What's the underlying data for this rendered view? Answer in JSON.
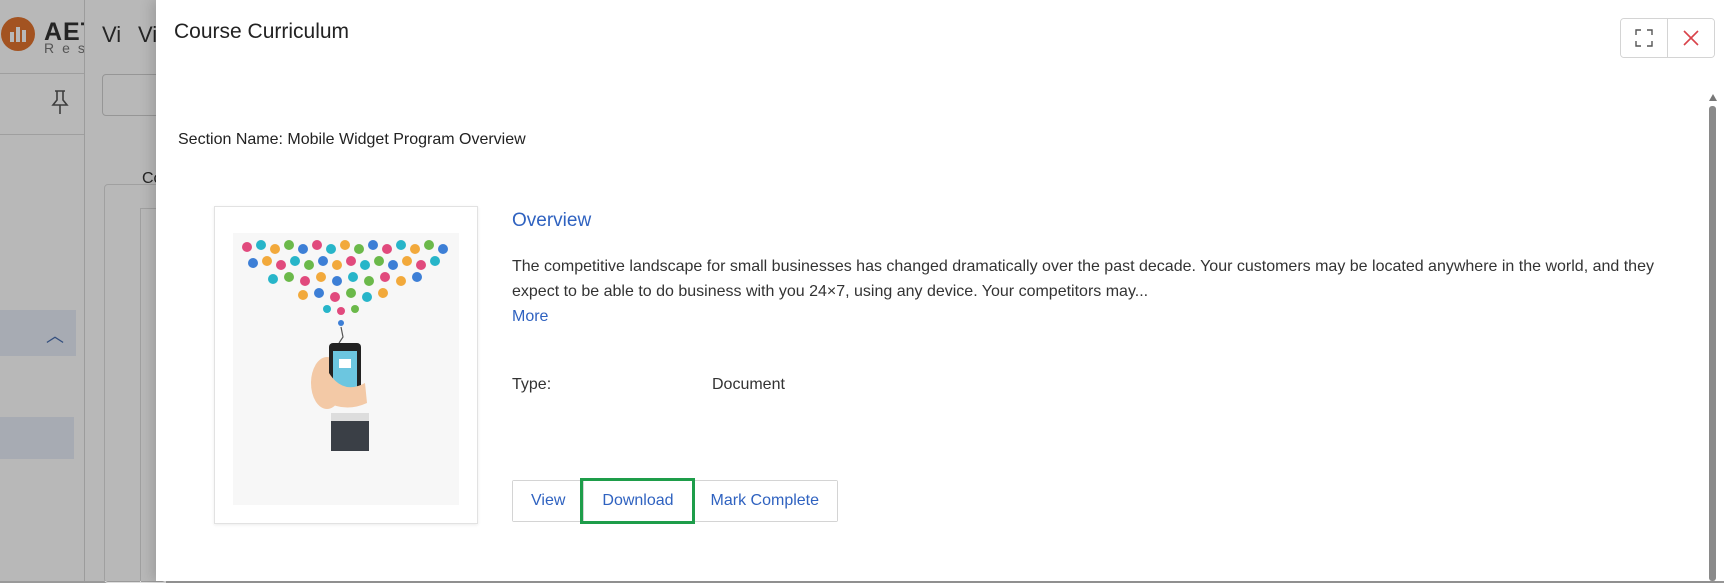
{
  "background": {
    "brand_name": "AET",
    "brand_sub": "Res",
    "tab_fragment_1": "Vi",
    "tab_fragment_2": "Vi",
    "content_fragment": "Co"
  },
  "modal": {
    "title": "Course Curriculum",
    "expand_icon": "expand-icon",
    "close_icon": "close-icon",
    "section_name": "Section Name: Mobile Widget Program Overview",
    "item": {
      "title": "Overview",
      "description": "The competitive landscape for small businesses has changed dramatically over the past decade. Your customers may be located anywhere in the world, and they expect to be able to do business with you 24×7, using any device. Your competitors may...",
      "more_label": "More",
      "type_label": "Type:",
      "type_value": "Document",
      "thumbnail_icon": "mobile-apps-illustration"
    },
    "actions": {
      "view_label": "View",
      "download_label": "Download",
      "mark_complete_label": "Mark Complete"
    }
  },
  "colors": {
    "accent": "#2f62c0",
    "close": "#d9434a",
    "highlight": "#1e9d4a",
    "logo": "#e2742e"
  }
}
